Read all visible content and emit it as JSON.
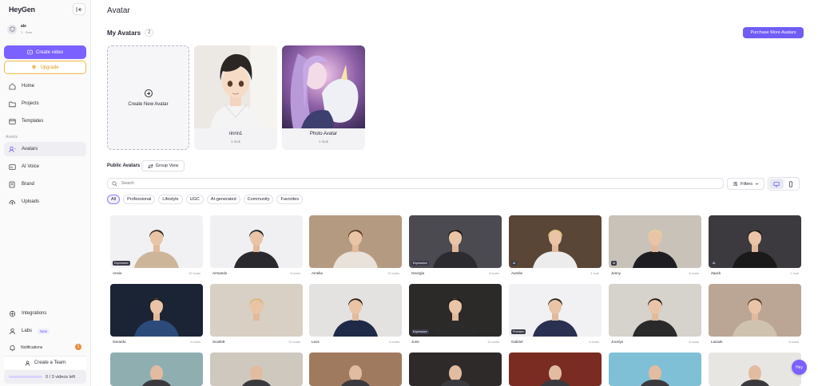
{
  "sidebar": {
    "logo": "HeyGen",
    "user": {
      "name": "ale",
      "meta": "1 · Free"
    },
    "create_video": "Create video",
    "upgrade": "Upgrade",
    "nav": [
      {
        "label": "Home",
        "icon": "home-icon"
      },
      {
        "label": "Projects",
        "icon": "folder-icon"
      },
      {
        "label": "Templates",
        "icon": "template-icon"
      }
    ],
    "assets_label": "Assets",
    "assets": [
      {
        "label": "Avatars",
        "icon": "avatar-icon",
        "active": true
      },
      {
        "label": "AI Voice",
        "icon": "voice-icon"
      },
      {
        "label": "Brand",
        "icon": "brand-icon"
      },
      {
        "label": "Uploads",
        "icon": "upload-icon"
      }
    ],
    "integrations": "Integrations",
    "labs": "Labs",
    "labs_badge": "New",
    "notifications": "Notifications",
    "notifications_count": "1",
    "create_team": "Create a Team",
    "videos_left": "0 / 3 videos left"
  },
  "main": {
    "title": "Avatar",
    "my_avatars": {
      "title": "My Avatars",
      "count": "2"
    },
    "purchase_button": "Purchase More Avatars",
    "create_new": "Create New Avatar",
    "my_cards": [
      {
        "name": "rinrin1",
        "looks": "1 look"
      },
      {
        "name": "Photo Avatar",
        "looks": "1 look"
      }
    ],
    "public_title": "Public Avatars",
    "group_view": "Group View",
    "search_placeholder": "Search",
    "filters": "Filters",
    "chips": [
      "All",
      "Professional",
      "Lifestyle",
      "UGC",
      "AI-generated",
      "Community",
      "Favorites"
    ],
    "active_chip": "All",
    "grid": [
      {
        "name": "Annie",
        "looks": "37 looks",
        "tag": "Expressive"
      },
      {
        "name": "Armando",
        "looks": "8 looks",
        "tag": ""
      },
      {
        "name": "Amelia",
        "looks": "12 looks",
        "tag": ""
      },
      {
        "name": "Georgia",
        "looks": "8 looks",
        "tag": "Expressive"
      },
      {
        "name": "Aurelie",
        "looks": "1 look",
        "tag": "AI"
      },
      {
        "name": "Jenny",
        "looks": "8 looks",
        "tag": "AI"
      },
      {
        "name": "Zaack",
        "looks": "1 look",
        "tag": "AI"
      },
      {
        "name": "Gerardo",
        "looks": "8 looks",
        "tag": ""
      },
      {
        "name": "Scarlett",
        "looks": "10 looks",
        "tag": ""
      },
      {
        "name": "Leos",
        "looks": "8 looks",
        "tag": ""
      },
      {
        "name": "June",
        "looks": "10 looks",
        "tag": "Expressive"
      },
      {
        "name": "Gabriel",
        "looks": "4 looks",
        "tag": "Premium"
      },
      {
        "name": "Jocelyn",
        "looks": "8 looks",
        "tag": ""
      },
      {
        "name": "Lazaok",
        "looks": "8 looks",
        "tag": ""
      }
    ],
    "help_button": "Hey"
  },
  "colors": {
    "accent": "#7b61ff",
    "upgrade": "#f3b94d"
  }
}
